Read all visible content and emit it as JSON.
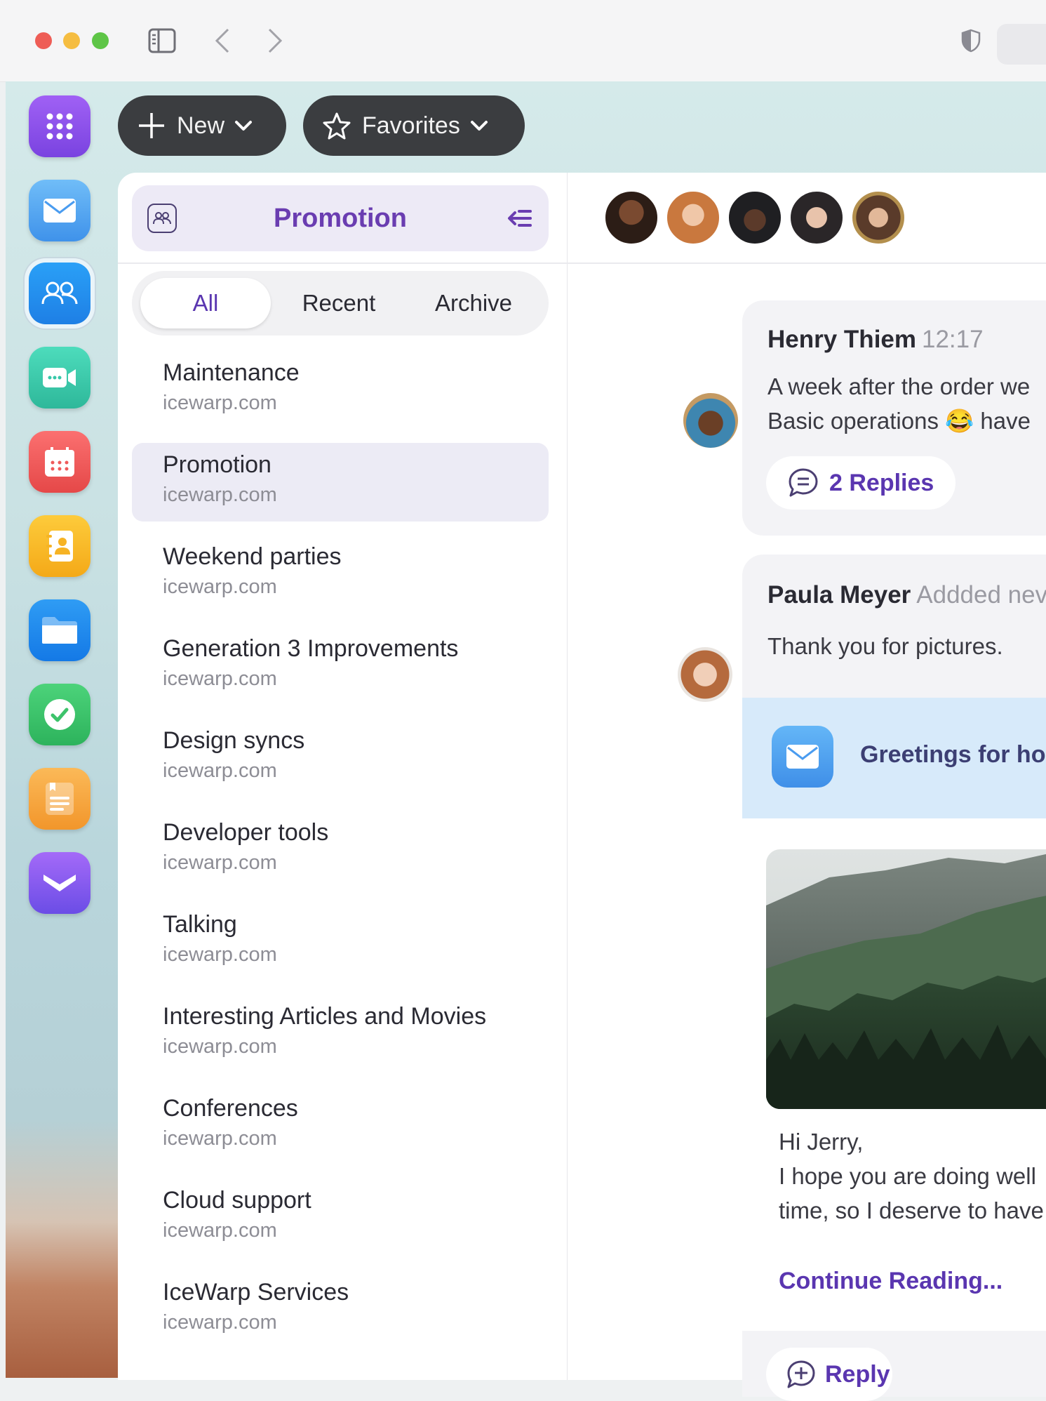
{
  "toolbar": {
    "new_label": "New",
    "favorites_label": "Favorites"
  },
  "dock": {
    "apps": [
      {
        "name": "apps-grid",
        "color": "#8b52e6"
      },
      {
        "name": "mail",
        "color": "#4aa6f4"
      },
      {
        "name": "teamchat",
        "color": "#2196f3"
      },
      {
        "name": "meetings",
        "color": "#35c8a9"
      },
      {
        "name": "calendar",
        "color": "#f25c5c"
      },
      {
        "name": "contacts",
        "color": "#f8b81f"
      },
      {
        "name": "files",
        "color": "#2b8ff0"
      },
      {
        "name": "tasks",
        "color": "#3dc36b"
      },
      {
        "name": "notes",
        "color": "#f6a73b"
      },
      {
        "name": "docs",
        "color": "#8758f0"
      }
    ]
  },
  "group": {
    "title": "Promotion"
  },
  "tabs": {
    "all": "All",
    "recent": "Recent",
    "archive": "Archive"
  },
  "conversations": [
    {
      "title": "Maintenance",
      "sub": "icewarp.com"
    },
    {
      "title": "Promotion",
      "sub": "icewarp.com",
      "selected": true
    },
    {
      "title": "Weekend parties",
      "sub": "icewarp.com"
    },
    {
      "title": "Generation 3 Improvements",
      "sub": "icewarp.com"
    },
    {
      "title": "Design syncs",
      "sub": "icewarp.com"
    },
    {
      "title": "Developer tools",
      "sub": "icewarp.com"
    },
    {
      "title": "Talking",
      "sub": "icewarp.com"
    },
    {
      "title": "Interesting Articles and Movies",
      "sub": "icewarp.com"
    },
    {
      "title": "Conferences",
      "sub": "icewarp.com"
    },
    {
      "title": "Cloud support",
      "sub": "icewarp.com"
    },
    {
      "title": "IceWarp Services",
      "sub": "icewarp.com"
    }
  ],
  "messages": {
    "m1": {
      "sender": "Henry Thiem",
      "time": "12:17",
      "line1": "A week after the order we",
      "line2_a": "Basic operations",
      "emoji": "😂",
      "line2_b": "have",
      "replies": "2 Replies"
    },
    "m2": {
      "sender": "Paula Meyer",
      "meta": "Addded nev",
      "text": "Thank you for pictures.",
      "email_subject": "Greetings for holi",
      "body1": "Hi Jerry,",
      "body2": "I hope you are doing well",
      "body3": "time, so I deserve to have",
      "continue": "Continue Reading...",
      "reply": "Reply"
    }
  },
  "colors": {
    "accent": "#5a36b0",
    "pill": "#3b3d40"
  }
}
